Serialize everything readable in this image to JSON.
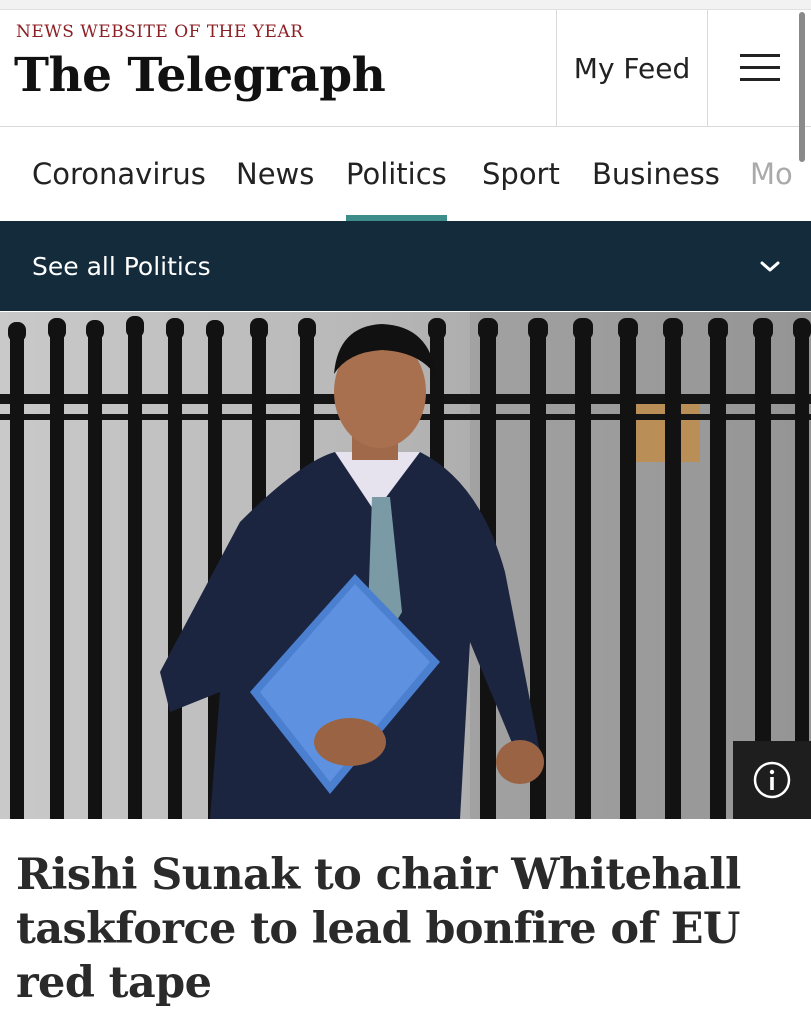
{
  "masthead": {
    "tagline": "NEWS WEBSITE OF THE YEAR",
    "logo_text": "The Telegraph",
    "my_feed_label": "My Feed",
    "menu_icon": "hamburger-menu-icon"
  },
  "nav": {
    "items": [
      "Coronavirus",
      "News",
      "Politics",
      "Sport",
      "Business",
      "Mo"
    ],
    "active": "Politics",
    "accent_color": "#3d8d8a"
  },
  "subbar": {
    "label": "See all Politics",
    "icon": "chevron-down-icon",
    "background": "#132b3b"
  },
  "hero": {
    "info_icon": "info-icon"
  },
  "article": {
    "headline": "Rishi Sunak to chair Whitehall taskforce to lead bonfire of EU red tape"
  },
  "colors": {
    "tagline": "#8c1f24"
  }
}
